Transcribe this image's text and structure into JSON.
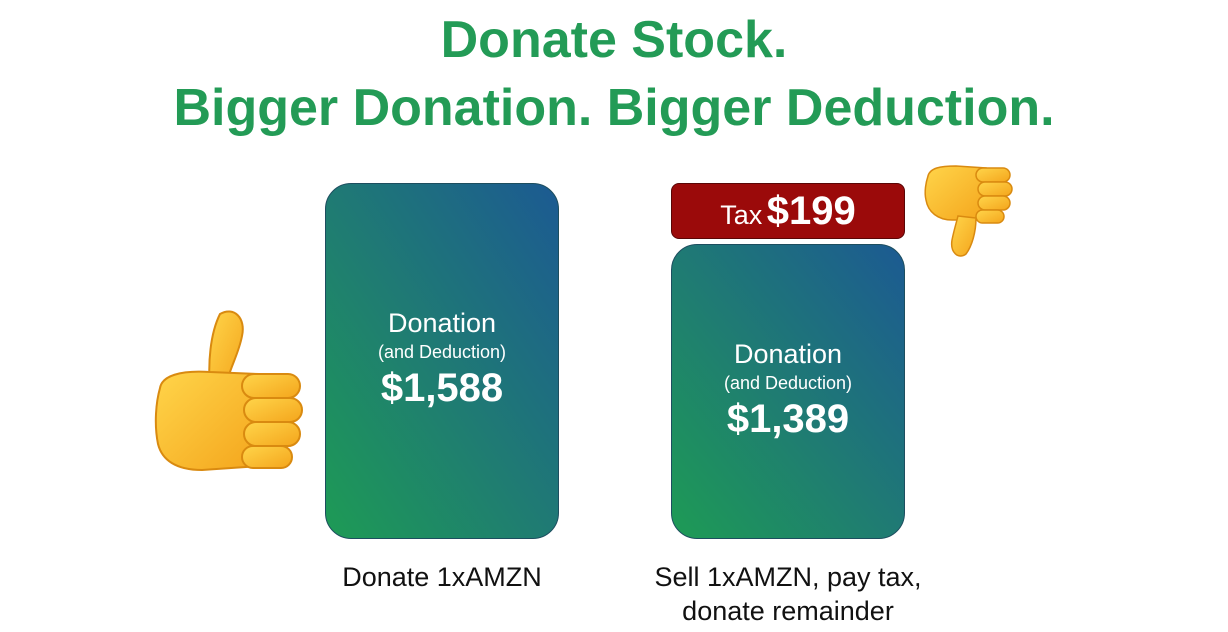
{
  "headline": {
    "line1": "Donate Stock.",
    "line2": "Bigger Donation. Bigger Deduction."
  },
  "left_option": {
    "card_title": "Donation",
    "card_subtitle": "(and Deduction)",
    "card_amount": "$1,588",
    "caption": "Donate 1xAMZN",
    "icon": "thumbs-up-icon"
  },
  "right_option": {
    "tax_label": "Tax",
    "tax_amount": "$199",
    "card_title": "Donation",
    "card_subtitle": "(and Deduction)",
    "card_amount": "$1,389",
    "caption_line1": "Sell 1xAMZN, pay tax,",
    "caption_line2": "donate remainder",
    "icon": "thumbs-down-icon"
  },
  "colors": {
    "headline_green": "#239b56",
    "card_gradient_start": "#1e9b55",
    "card_gradient_end": "#1c5a92",
    "tax_red": "#9b0a0a"
  }
}
